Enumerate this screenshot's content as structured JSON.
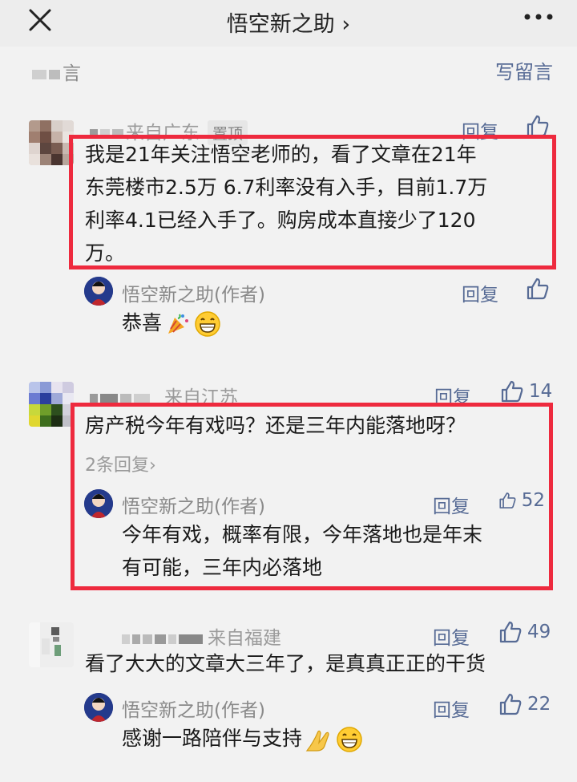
{
  "header": {
    "title": "悟空新之助 ›",
    "close_icon": "close-icon",
    "more_icon": "more-icon"
  },
  "comments_header": {
    "label": "言",
    "write_label": "写留言"
  },
  "comments": [
    {
      "location": "来自广东",
      "badge": "置顶",
      "reply_label": "回复",
      "like_count": "",
      "text": [
        "我是21年关注悟空老师的，看了文章在21年",
        "东莞楼市2.5万 6.7利率没有入手，目前1.7万",
        "利率4.1已经入手了。购房成本直接少了120",
        "万。"
      ],
      "author_reply": {
        "name": "悟空新之助(作者)",
        "reply_label": "回复",
        "like_count": "",
        "text": "恭喜"
      }
    },
    {
      "location": "来自江苏",
      "reply_label": "回复",
      "like_count": "14",
      "text": [
        "房产税今年有戏吗？还是三年内能落地呀？"
      ],
      "more_replies": "2条回复›",
      "author_reply": {
        "name": "悟空新之助(作者)",
        "reply_label": "回复",
        "like_count": "52",
        "text": [
          "今年有戏，概率有限，今年落地也是年末",
          "有可能，三年内必落地"
        ]
      }
    },
    {
      "location": "来自福建",
      "reply_label": "回复",
      "like_count": "49",
      "text": [
        "看了大大的文章大三年了，是真真正正的干货"
      ],
      "author_reply": {
        "name": "悟空新之助(作者)",
        "reply_label": "回复",
        "like_count": "22",
        "text": "感谢一路陪伴与支持"
      }
    }
  ],
  "colors": {
    "link": "#576b95",
    "highlight": "#ee2a3e",
    "background": "#f2f2f2"
  }
}
